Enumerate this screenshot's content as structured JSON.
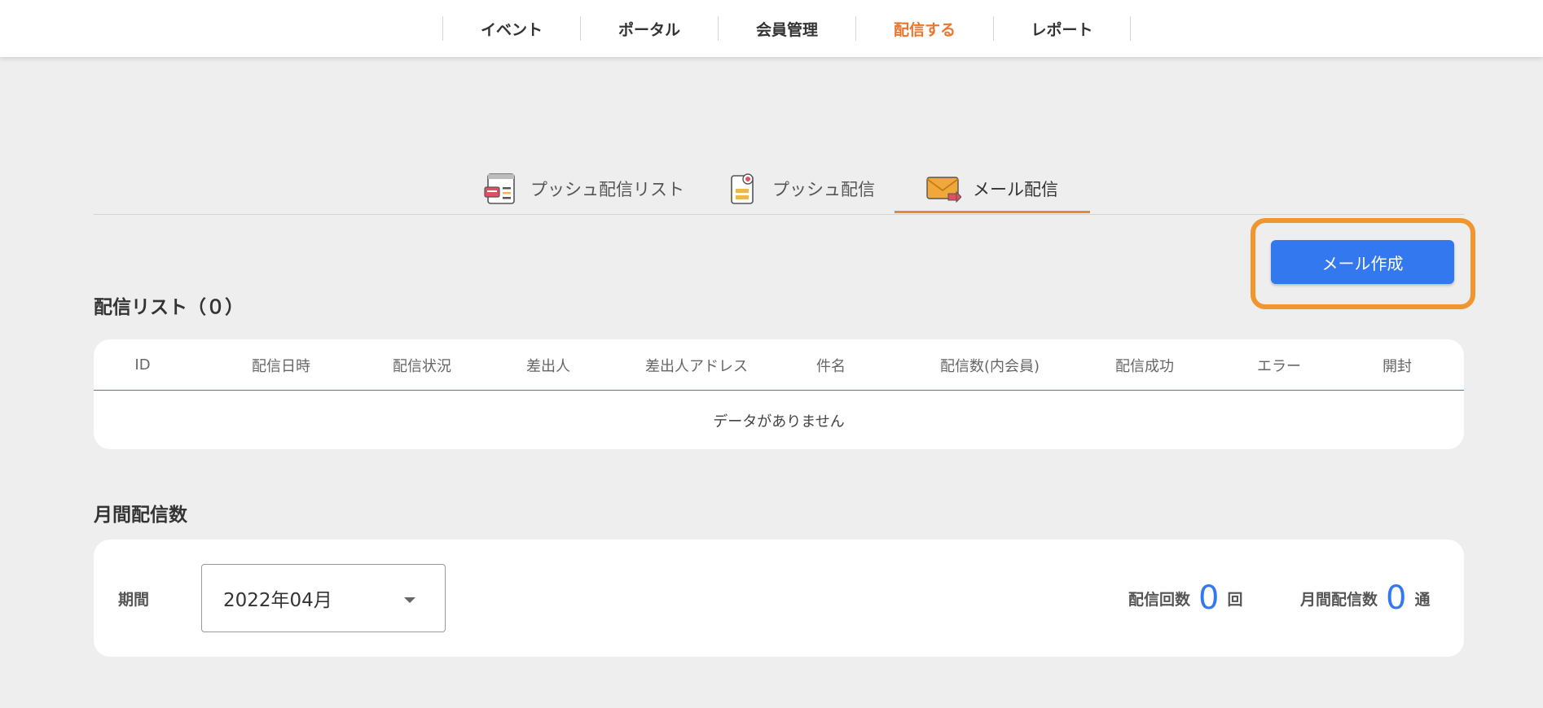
{
  "topnav": {
    "items": [
      {
        "label": "イベント"
      },
      {
        "label": "ポータル"
      },
      {
        "label": "会員管理"
      },
      {
        "label": "配信する"
      },
      {
        "label": "レポート"
      }
    ],
    "active_color": "#e8772d"
  },
  "tabs": [
    {
      "label": "プッシュ配信リスト",
      "icon": "push-list-icon"
    },
    {
      "label": "プッシュ配信",
      "icon": "push-document-icon"
    },
    {
      "label": "メール配信",
      "icon": "mail-icon"
    }
  ],
  "create_button": {
    "label": "メール作成",
    "color": "#3478f0",
    "highlight_color": "#f0962f"
  },
  "delivery_list": {
    "title": "配信リスト（０）",
    "columns": [
      "ID",
      "配信日時",
      "配信状況",
      "差出人",
      "差出人アドレス",
      "件名",
      "配信数(内会員)",
      "配信成功",
      "エラー",
      "開封"
    ],
    "empty_message": "データがありません"
  },
  "monthly": {
    "title": "月間配信数",
    "period_label": "期間",
    "period_value": "2022年04月",
    "count_label": "配信回数",
    "count_value": "0",
    "count_unit": "回",
    "monthly_label": "月間配信数",
    "monthly_value": "0",
    "monthly_unit": "通"
  }
}
